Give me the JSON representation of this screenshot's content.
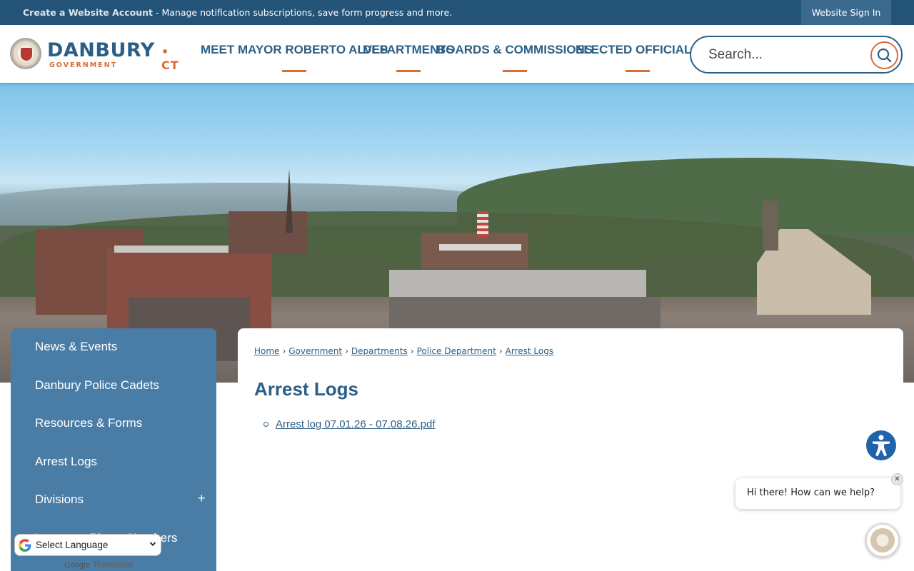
{
  "topbar": {
    "account_link": "Create a Website Account",
    "account_msg": " - Manage notification subscriptions, save form progress and more.",
    "signin": "Website Sign In"
  },
  "logo": {
    "name": "DANBURY",
    "sub": "GOVERNMENT",
    "state": "• CT"
  },
  "nav": [
    {
      "label": "MEET MAYOR ROBERTO ALVES"
    },
    {
      "label": "DEPARTMENTS"
    },
    {
      "label": "BOARDS & COMMISSIONS"
    },
    {
      "label": "ELECTED OFFICIALS"
    }
  ],
  "search": {
    "placeholder": "Search..."
  },
  "sidebar": {
    "items": [
      {
        "label": "News & Events"
      },
      {
        "label": "Danbury Police Cadets"
      },
      {
        "label": "Resources & Forms"
      },
      {
        "label": "Arrest Logs"
      },
      {
        "label": "Divisions",
        "expander": "+"
      },
      {
        "label": "Important Phone Numbers"
      }
    ]
  },
  "breadcrumb": [
    {
      "label": "Home"
    },
    {
      "label": "Government"
    },
    {
      "label": "Departments"
    },
    {
      "label": "Police Department"
    },
    {
      "label": "Arrest Logs"
    }
  ],
  "breadcrumb_sep": "›",
  "page": {
    "title": "Arrest Logs",
    "files": [
      {
        "label": "Arrest log 07.01.26 - 07.08.26.pdf"
      }
    ]
  },
  "chat": {
    "greeting": "Hi there! How can we help?",
    "close": "✕"
  },
  "translate": {
    "select_label": "Select Language",
    "powered_word": "Google",
    "powered_label": "Translate"
  },
  "colors": {
    "brand_blue": "#2b5f86",
    "accent_orange": "#d96c34",
    "topbar": "#235478",
    "sidebar": "#4a7da6"
  }
}
